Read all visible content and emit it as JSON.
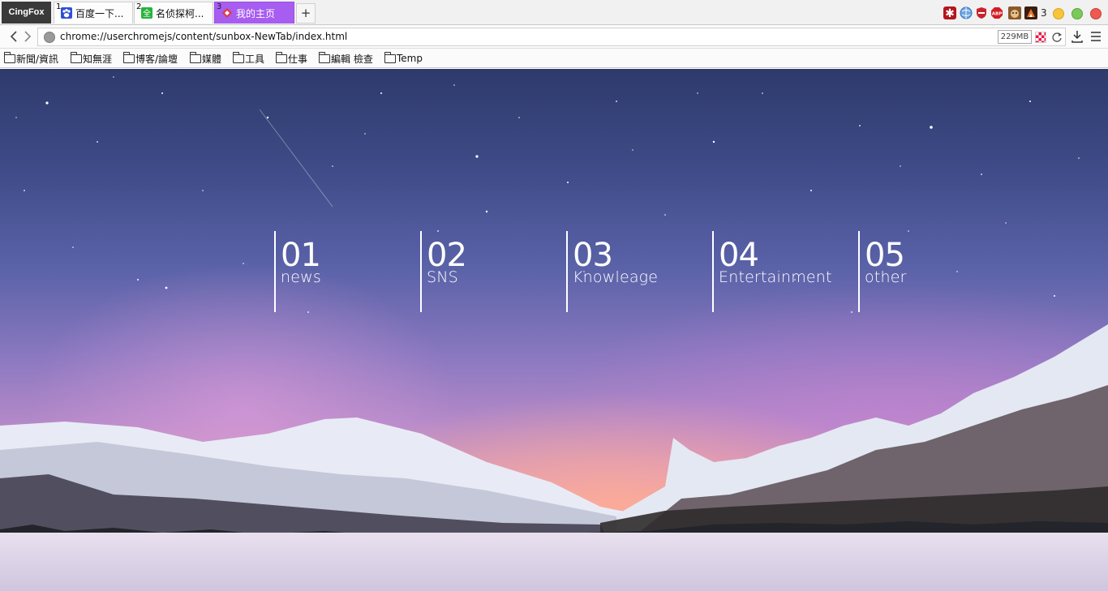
{
  "window": {
    "brand": "CingFox",
    "tabs": [
      {
        "num": "1",
        "label": "百度一下...",
        "icon": "paw-icon",
        "active": false
      },
      {
        "num": "2",
        "label": "名侦探柯...",
        "icon": "green-square-icon",
        "active": false
      },
      {
        "num": "3",
        "label": "我的主页",
        "icon": "diamond-icon",
        "active": true
      }
    ],
    "new_tab_label": "+",
    "extension_count": "3",
    "colors": {
      "active_tab": "#a65df0",
      "minimize": "#f7c638",
      "maximize": "#7cc95b",
      "close": "#ee5a52"
    }
  },
  "navbar": {
    "back_icon": "back-arrow-icon",
    "forward_icon": "forward-arrow-icon",
    "url": "chrome://userchromejs/content/sunbox-NewTab/index.html",
    "memory": "229MB"
  },
  "bookmarks": [
    {
      "label": "新聞/資訊"
    },
    {
      "label": "知無涯"
    },
    {
      "label": "博客/論壇"
    },
    {
      "label": "媒體"
    },
    {
      "label": "工具"
    },
    {
      "label": "仕事"
    },
    {
      "label": "編輯 檢查"
    },
    {
      "label": "Temp"
    }
  ],
  "tiles": [
    {
      "num": "01",
      "label": "news"
    },
    {
      "num": "02",
      "label": "SNS"
    },
    {
      "num": "03",
      "label": "Knowleage"
    },
    {
      "num": "04",
      "label": "Entertainment"
    },
    {
      "num": "05",
      "label": "other"
    }
  ]
}
